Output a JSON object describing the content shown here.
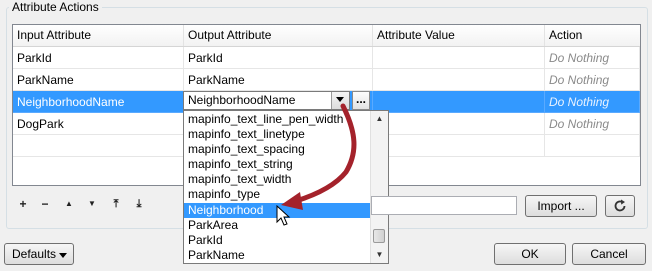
{
  "group_title": "Attribute Actions",
  "columns": [
    "Input Attribute",
    "Output Attribute",
    "Attribute Value",
    "Action"
  ],
  "rows": [
    {
      "input": "ParkId",
      "output": "ParkId",
      "value": "",
      "action": "Do Nothing"
    },
    {
      "input": "ParkName",
      "output": "ParkName",
      "value": "",
      "action": "Do Nothing"
    },
    {
      "input": "NeighborhoodName",
      "output": "NeighborhoodName",
      "value": "",
      "action": "Do Nothing"
    },
    {
      "input": "DogPark",
      "output": "",
      "value": "",
      "action": "Do Nothing"
    }
  ],
  "combo": {
    "value": "NeighborhoodName",
    "ellipsis": "..."
  },
  "dropdown_items": [
    "mapinfo_text_line_pen_width",
    "mapinfo_text_linetype",
    "mapinfo_text_spacing",
    "mapinfo_text_string",
    "mapinfo_text_width",
    "mapinfo_type",
    "Neighborhood",
    "ParkArea",
    "ParkId",
    "ParkName"
  ],
  "toolbar": {
    "add": "+",
    "remove": "−",
    "up": "▲",
    "down": "▼",
    "top": "⤒",
    "bottom": "⤓"
  },
  "import_label": "Import ...",
  "defaults_label": "Defaults",
  "ok_label": "OK",
  "cancel_label": "Cancel",
  "colors": {
    "selection": "#3399ff",
    "annotation_arrow": "#a4222b"
  }
}
